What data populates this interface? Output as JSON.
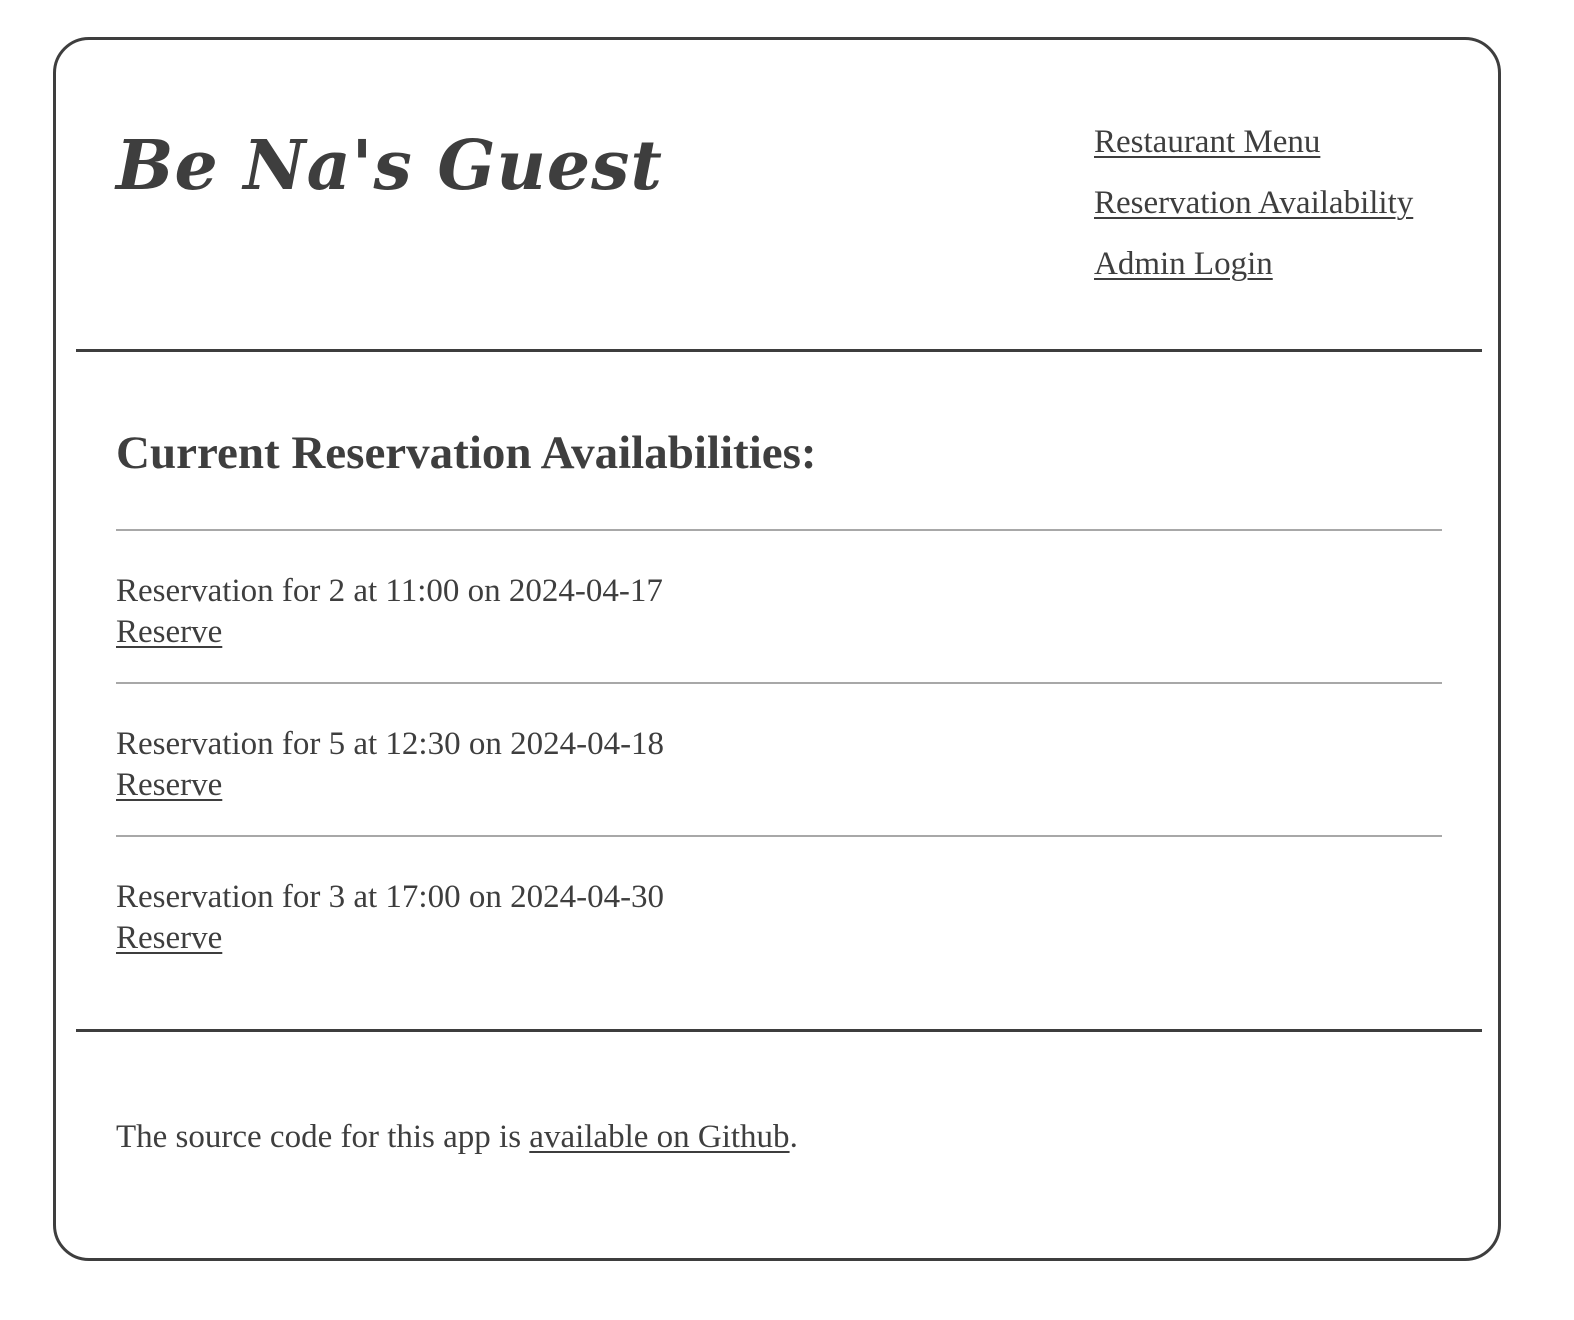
{
  "header": {
    "site_title": "Be Na's Guest",
    "nav": [
      {
        "label": "Restaurant Menu"
      },
      {
        "label": "Reservation Availability"
      },
      {
        "label": "Admin Login"
      }
    ]
  },
  "main": {
    "heading": "Current Reservation Availabilities:",
    "reservations": [
      {
        "text": "Reservation for 2 at 11:00 on 2024-04-17",
        "action_label": "Reserve"
      },
      {
        "text": "Reservation for 5 at 12:30 on 2024-04-18",
        "action_label": "Reserve"
      },
      {
        "text": "Reservation for 3 at 17:00 on 2024-04-30",
        "action_label": "Reserve"
      }
    ]
  },
  "footer": {
    "text_before": "The source code for this app is ",
    "link_label": "available on Github",
    "text_after": "."
  },
  "colors": {
    "text": "#3e3e3e",
    "divider": "#a8a8a8",
    "background": "#ffffff"
  }
}
